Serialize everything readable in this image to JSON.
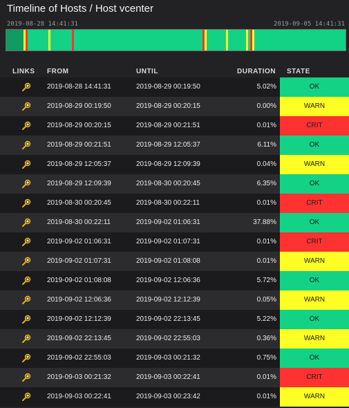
{
  "page": {
    "title": "Timeline of Hosts / Host vcenter"
  },
  "timeline": {
    "start_label": "2019-08-28 14:41:31",
    "end_label": "2019-09-05 14:41:31",
    "colors": {
      "ok": "#13d286",
      "warn": "#ffff26",
      "crit": "#ff3232",
      "past": "#119a62"
    }
  },
  "table": {
    "headers": {
      "links": "LINKS",
      "from": "FROM",
      "until": "UNTIL",
      "duration": "DURATION",
      "state": "STATE"
    },
    "rows": [
      {
        "from": "2019-08-28 14:41:31",
        "until": "2019-08-29 00:19:50",
        "duration": "5.02%",
        "state": "OK"
      },
      {
        "from": "2019-08-29 00:19:50",
        "until": "2019-08-29 00:20:15",
        "duration": "0.00%",
        "state": "WARN"
      },
      {
        "from": "2019-08-29 00:20:15",
        "until": "2019-08-29 00:21:51",
        "duration": "0.01%",
        "state": "CRIT"
      },
      {
        "from": "2019-08-29 00:21:51",
        "until": "2019-08-29 12:05:37",
        "duration": "6.11%",
        "state": "OK"
      },
      {
        "from": "2019-08-29 12:05:37",
        "until": "2019-08-29 12:09:39",
        "duration": "0.04%",
        "state": "WARN"
      },
      {
        "from": "2019-08-29 12:09:39",
        "until": "2019-08-30 00:20:45",
        "duration": "6.35%",
        "state": "OK"
      },
      {
        "from": "2019-08-30 00:20:45",
        "until": "2019-08-30 00:22:11",
        "duration": "0.01%",
        "state": "CRIT"
      },
      {
        "from": "2019-08-30 00:22:11",
        "until": "2019-09-02 01:06:31",
        "duration": "37.88%",
        "state": "OK"
      },
      {
        "from": "2019-09-02 01:06:31",
        "until": "2019-09-02 01:07:31",
        "duration": "0.01%",
        "state": "CRIT"
      },
      {
        "from": "2019-09-02 01:07:31",
        "until": "2019-09-02 01:08:08",
        "duration": "0.01%",
        "state": "WARN"
      },
      {
        "from": "2019-09-02 01:08:08",
        "until": "2019-09-02 12:06:36",
        "duration": "5.72%",
        "state": "OK"
      },
      {
        "from": "2019-09-02 12:06:36",
        "until": "2019-09-02 12:12:39",
        "duration": "0.05%",
        "state": "WARN"
      },
      {
        "from": "2019-09-02 12:12:39",
        "until": "2019-09-02 22:13:45",
        "duration": "5.22%",
        "state": "OK"
      },
      {
        "from": "2019-09-02 22:13:45",
        "until": "2019-09-02 22:55:03",
        "duration": "0.36%",
        "state": "WARN"
      },
      {
        "from": "2019-09-02 22:55:03",
        "until": "2019-09-03 00:21:32",
        "duration": "0.75%",
        "state": "OK"
      },
      {
        "from": "2019-09-03 00:21:32",
        "until": "2019-09-03 00:22:41",
        "duration": "0.01%",
        "state": "CRIT"
      },
      {
        "from": "2019-09-03 00:22:41",
        "until": "2019-09-03 00:23:42",
        "duration": "0.01%",
        "state": "WARN"
      }
    ]
  },
  "icons": {
    "link": "search-link-icon"
  }
}
